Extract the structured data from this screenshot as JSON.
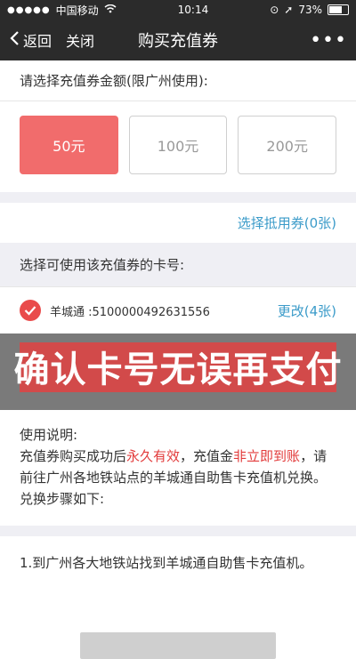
{
  "status": {
    "carrier": "中国移动",
    "time": "10:14",
    "battery": "73%"
  },
  "nav": {
    "back": "返回",
    "close": "关闭",
    "title": "购买充值券",
    "more": "•••"
  },
  "select_amount": {
    "title": "请选择充值券金额(限广州使用):",
    "options": [
      "50元",
      "100元",
      "200元"
    ]
  },
  "voucher": {
    "label": "选择抵用券(0张)"
  },
  "card": {
    "title": "选择可使用该充值券的卡号:",
    "number": "羊城通 :5100000492631556",
    "change": "更改(4张)"
  },
  "banner": {
    "text": "确认卡号无误再支付"
  },
  "instructions": {
    "heading": "使用说明:",
    "line1_a": "充值券购买成功后",
    "line1_b": "永久有效",
    "line1_c": "，充值金",
    "line1_d": "非立即到账",
    "line1_e": "，请前往广州各地铁站点的羊城通自助售卡充值机兑换。 兑换步骤如下:"
  },
  "steps": {
    "step1": "1.到广州各大地铁站找到羊城通自助售卡充值机。"
  }
}
